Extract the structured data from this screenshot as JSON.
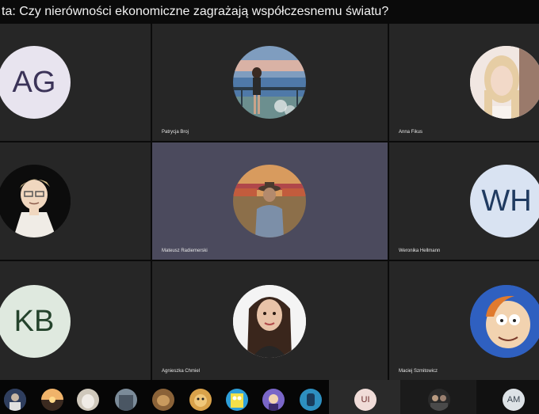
{
  "meeting": {
    "title": "ta: Czy nierówności ekonomiczne zagrażają współczesnemu światu?"
  },
  "participants": [
    {
      "name": "",
      "initials": "AG",
      "bg": "#e8e4ef",
      "fg": "#3b3358"
    },
    {
      "name": "Patrycja Broj",
      "photo": "beach-photo"
    },
    {
      "name": "Anna Fikus",
      "photo": "selfie-photo"
    },
    {
      "name": "",
      "photo": "cartoon-photo"
    },
    {
      "name": "Mateusz Radiemerski",
      "photo": "field-photo",
      "active": true
    },
    {
      "name": "Weronika Hellmann",
      "initials": "WH",
      "bg": "#d9e3f2",
      "fg": "#1f3a60"
    },
    {
      "name": "",
      "initials": "KB",
      "bg": "#dfe9df",
      "fg": "#24432c"
    },
    {
      "name": "Agnieszka Chmiel",
      "photo": "portrait-photo"
    },
    {
      "name": "Maciej Szmitowicz",
      "photo": "cartoon-face-photo"
    }
  ],
  "strip": {
    "ui_initials": "UI",
    "am_initials": "AM"
  },
  "colors": {
    "tile": "#262626",
    "active_tile": "#4b4a5d",
    "background": "#0b0b0b"
  }
}
